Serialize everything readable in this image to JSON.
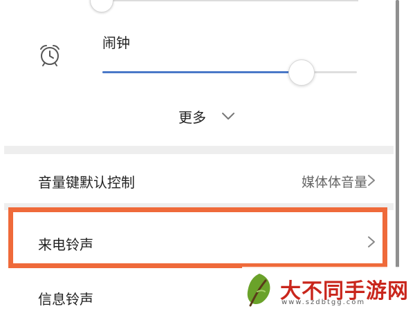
{
  "top_slider": {
    "level": 0.0
  },
  "alarm": {
    "label": "闹钟",
    "icon": "alarm-clock-icon",
    "volume_level": 0.78
  },
  "more": {
    "label": "更多",
    "icon": "chevron-down-icon"
  },
  "settings": [
    {
      "label": "音量键默认控制",
      "value": "媒体体音量",
      "icon": "chevron-right-icon"
    },
    {
      "label": "来电铃声",
      "icon": "chevron-right-icon",
      "highlighted": true
    },
    {
      "label": "信息铃声"
    }
  ],
  "watermark": {
    "title": "大不同手游网",
    "url": "www.szdbtgg.com",
    "icon": "leaf-logo-icon"
  },
  "colors": {
    "accent": "#4a78c8",
    "highlight_border": "#ef6a3a",
    "watermark_red": "#c9261c",
    "watermark_green": "#6aa22a"
  }
}
